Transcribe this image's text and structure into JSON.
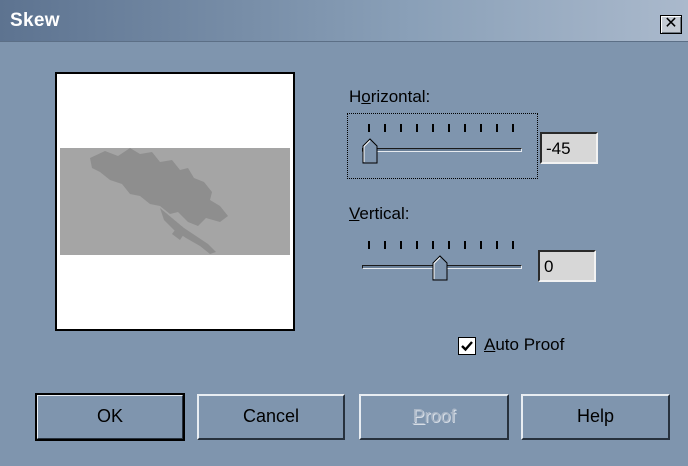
{
  "window": {
    "title": "Skew"
  },
  "horizontal": {
    "label_prefix": "H",
    "label_mnemonic": "o",
    "label_rest": "rizontal:",
    "value": "-45",
    "slider_level": 0.0
  },
  "vertical": {
    "label_mnemonic": "V",
    "label_rest": "ertical:",
    "value": "0",
    "slider_level": 0.5
  },
  "auto_proof": {
    "label_mnemonic": "A",
    "label_rest": "uto Proof",
    "checked": true
  },
  "buttons": {
    "ok": "OK",
    "cancel": "Cancel",
    "proof_mnemonic": "P",
    "proof_rest": "roof",
    "help": "Help"
  },
  "colors": {
    "dialog_bg": "#7f95ae",
    "preview_band": "#a5a5a5",
    "disabled_text": "#a9b6c6"
  }
}
